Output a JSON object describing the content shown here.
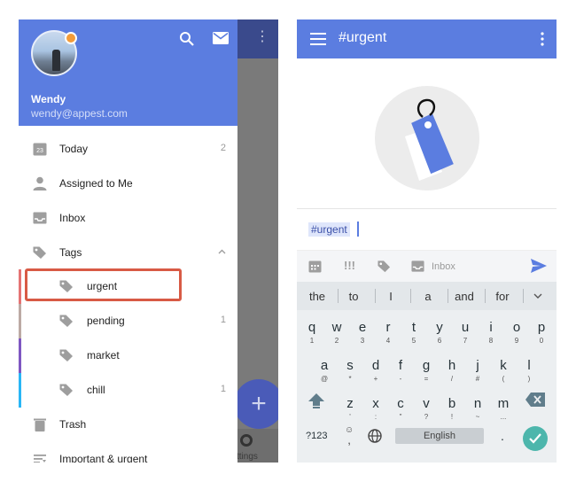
{
  "left": {
    "background_app": {
      "settings_label": "ttings",
      "fab_symbol": "+",
      "overflow_symbol": "⋮"
    },
    "drawer": {
      "user_name": "Wendy",
      "user_email": "wendy@appest.com",
      "header_icons": [
        "search-icon",
        "mail-icon"
      ],
      "items": [
        {
          "label": "Today",
          "count": "2",
          "icon": "calendar-icon",
          "calendar_day": "23"
        },
        {
          "label": "Assigned to Me",
          "count": "",
          "icon": "person-icon"
        },
        {
          "label": "Inbox",
          "count": "",
          "icon": "inbox-icon"
        },
        {
          "label": "Tags",
          "count": "",
          "icon": "tag-icon",
          "expanded": true
        },
        {
          "label": "urgent",
          "count": "",
          "icon": "tag-icon",
          "color": "#e57373"
        },
        {
          "label": "pending",
          "count": "1",
          "icon": "tag-icon",
          "color": "#bcaaa4"
        },
        {
          "label": "market",
          "count": "",
          "icon": "tag-icon",
          "color": "#7e57c2"
        },
        {
          "label": "chill",
          "count": "1",
          "icon": "tag-icon",
          "color": "#29b6f6"
        },
        {
          "label": "Trash",
          "count": "",
          "icon": "trash-icon"
        },
        {
          "label": "Important & urgent",
          "count": "",
          "icon": "filter-icon"
        }
      ],
      "accent_color": "#5b7de0",
      "highlight_color": "#d85a45"
    }
  },
  "right": {
    "app_bar": {
      "title": "#urgent"
    },
    "input": {
      "value": "#urgent"
    },
    "quick_bar": {
      "priority_label": "!!!",
      "inbox_label": "Inbox"
    },
    "keyboard": {
      "suggestions": [
        "the",
        "to",
        "I",
        "a",
        "and",
        "for"
      ],
      "row1": [
        {
          "k": "q",
          "s": "1"
        },
        {
          "k": "w",
          "s": "2"
        },
        {
          "k": "e",
          "s": "3"
        },
        {
          "k": "r",
          "s": "4"
        },
        {
          "k": "t",
          "s": "5"
        },
        {
          "k": "y",
          "s": "6"
        },
        {
          "k": "u",
          "s": "7"
        },
        {
          "k": "i",
          "s": "8"
        },
        {
          "k": "o",
          "s": "9"
        },
        {
          "k": "p",
          "s": "0"
        }
      ],
      "row2": [
        {
          "k": "a",
          "s": "@"
        },
        {
          "k": "s",
          "s": "*"
        },
        {
          "k": "d",
          "s": "+"
        },
        {
          "k": "f",
          "s": "-"
        },
        {
          "k": "g",
          "s": "="
        },
        {
          "k": "h",
          "s": "/"
        },
        {
          "k": "j",
          "s": "#"
        },
        {
          "k": "k",
          "s": "("
        },
        {
          "k": "l",
          "s": ")"
        }
      ],
      "row3": [
        {
          "k": "z",
          "s": "'"
        },
        {
          "k": "x",
          "s": ":"
        },
        {
          "k": "c",
          "s": "\""
        },
        {
          "k": "v",
          "s": "?"
        },
        {
          "k": "b",
          "s": "!"
        },
        {
          "k": "n",
          "s": "~"
        },
        {
          "k": "m",
          "s": "..."
        }
      ],
      "key_123": "?123",
      "emoji_top": "☺",
      "emoji_bottom": ",",
      "space_label": "English",
      "period": "."
    }
  }
}
